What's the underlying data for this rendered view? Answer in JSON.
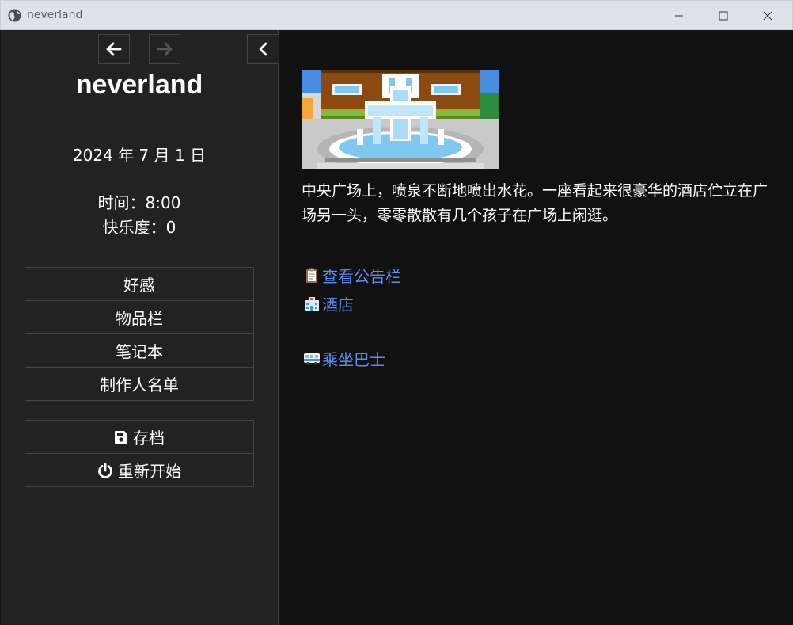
{
  "window": {
    "title": "neverland",
    "icon": "globe-icon",
    "controls": [
      "minimize-icon",
      "maximize-icon",
      "close-icon"
    ]
  },
  "sidebar": {
    "nav": {
      "back_icon": "arrow-left-icon",
      "forward_icon": "arrow-right-icon",
      "toggle_icon": "chevron-left-icon"
    },
    "title": "neverland",
    "date": "2024 年 7 月 1 日",
    "stats": {
      "time": "时间：8:00",
      "happiness": "快乐度：0"
    },
    "menu": [
      {
        "label": "好感"
      },
      {
        "label": "物品栏"
      },
      {
        "label": "笔记本"
      },
      {
        "label": "制作人名单"
      }
    ],
    "actions": [
      {
        "label": "存档",
        "icon": "save-icon"
      },
      {
        "label": "重新开始",
        "icon": "power-icon"
      }
    ]
  },
  "main": {
    "image": "fountain-plaza-pixel-art",
    "passage": "中央广场上，喷泉不断地喷出水花。一座看起来很豪华的酒店伫立在广场另一头，零零散散有几个孩子在广场上闲逛。",
    "links": [
      {
        "label": "查看公告栏",
        "icon": "clipboard-icon"
      },
      {
        "label": "酒店",
        "icon": "hotel-icon"
      },
      {
        "label": "乘坐巴士",
        "icon": "bus-icon"
      }
    ]
  },
  "colors": {
    "sidebar_bg": "#222222",
    "main_bg": "#111111",
    "link": "#5b8cf2",
    "border": "#444444",
    "titlebar": "#dee3eb"
  }
}
